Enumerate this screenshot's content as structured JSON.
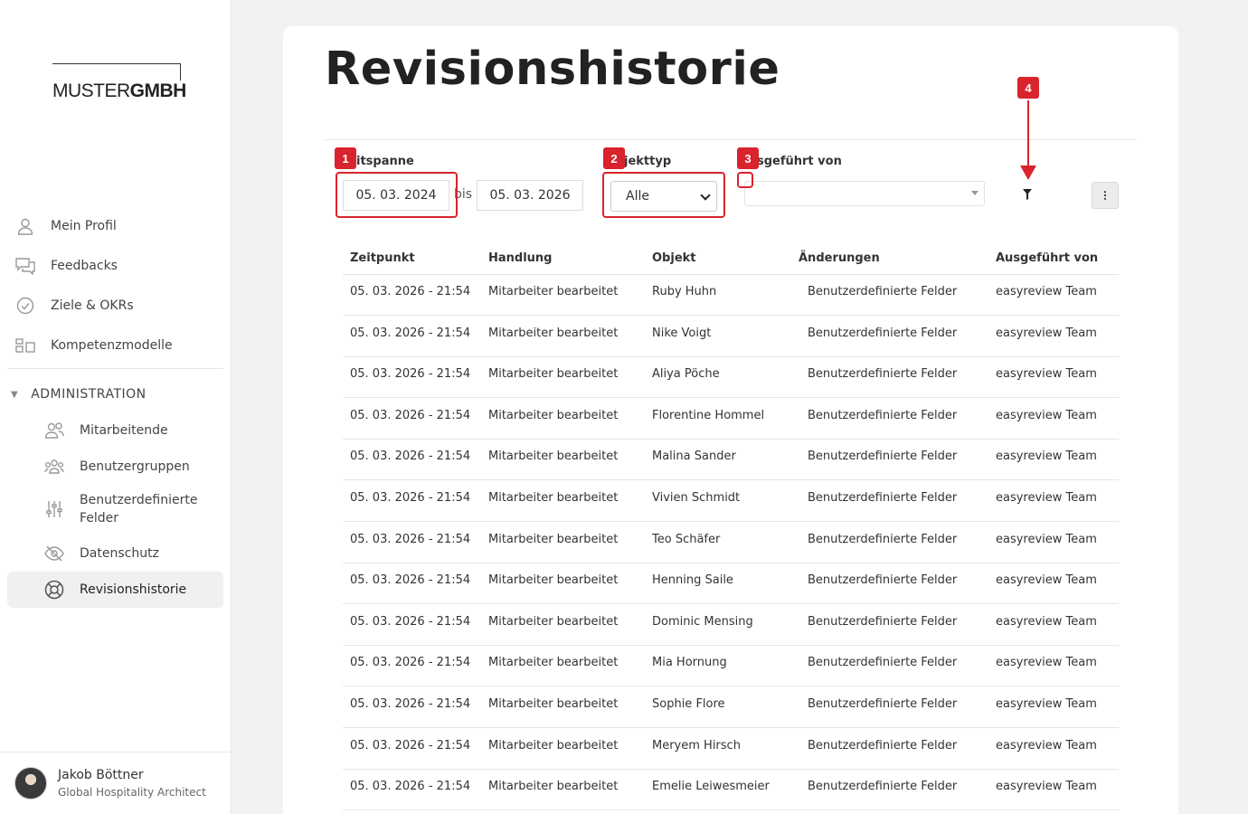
{
  "brand": {
    "logo_thin": "MUSTER",
    "logo_bold": "GMBH"
  },
  "sidebar": {
    "items": [
      {
        "label": "Mein Profil",
        "icon": "person-icon"
      },
      {
        "label": "Feedbacks",
        "icon": "chat-icon"
      },
      {
        "label": "Ziele & OKRs",
        "icon": "check-circle-icon"
      },
      {
        "label": "Kompetenzmodelle",
        "icon": "grid-icon"
      }
    ],
    "admin_heading": "ADMINISTRATION",
    "admin_items": [
      {
        "label": "Mitarbeitende",
        "icon": "people-icon"
      },
      {
        "label": "Benutzergruppen",
        "icon": "group-icon"
      },
      {
        "label": "Benutzerdefinierte Felder",
        "icon": "sliders-icon"
      },
      {
        "label": "Datenschutz",
        "icon": "eye-off-icon"
      },
      {
        "label": "Revisionshistorie",
        "icon": "lifebuoy-icon",
        "active": true
      }
    ]
  },
  "user": {
    "name": "Jakob Böttner",
    "role": "Global Hospitality Architect"
  },
  "page": {
    "title": "Revisionshistorie"
  },
  "filters": {
    "zeitspanne_label": "itspanne",
    "date_from": "05. 03. 2024",
    "bis": "bis",
    "date_to": "05. 03. 2026",
    "objekttyp_label": "jekttyp",
    "objekttyp_value": "Alle",
    "ausgefuehrt_label": "sgeführt von",
    "ausgefuehrt_value": ""
  },
  "annotations": [
    "1",
    "2",
    "3",
    "4"
  ],
  "table": {
    "headers": [
      "Zeitpunkt",
      "Handlung",
      "Objekt",
      "Änderungen",
      "Ausgeführt von"
    ],
    "rows": [
      [
        "05. 03. 2026 - 21:54",
        "Mitarbeiter bearbeitet",
        "Ruby Huhn",
        "Benutzerdefinierte Felder",
        "easyreview Team"
      ],
      [
        "05. 03. 2026 - 21:54",
        "Mitarbeiter bearbeitet",
        "Nike Voigt",
        "Benutzerdefinierte Felder",
        "easyreview Team"
      ],
      [
        "05. 03. 2026 - 21:54",
        "Mitarbeiter bearbeitet",
        "Aliya Pöche",
        "Benutzerdefinierte Felder",
        "easyreview Team"
      ],
      [
        "05. 03. 2026 - 21:54",
        "Mitarbeiter bearbeitet",
        "Florentine Hommel",
        "Benutzerdefinierte Felder",
        "easyreview Team"
      ],
      [
        "05. 03. 2026 - 21:54",
        "Mitarbeiter bearbeitet",
        "Malina Sander",
        "Benutzerdefinierte Felder",
        "easyreview Team"
      ],
      [
        "05. 03. 2026 - 21:54",
        "Mitarbeiter bearbeitet",
        "Vivien Schmidt",
        "Benutzerdefinierte Felder",
        "easyreview Team"
      ],
      [
        "05. 03. 2026 - 21:54",
        "Mitarbeiter bearbeitet",
        "Teo Schäfer",
        "Benutzerdefinierte Felder",
        "easyreview Team"
      ],
      [
        "05. 03. 2026 - 21:54",
        "Mitarbeiter bearbeitet",
        "Henning Saile",
        "Benutzerdefinierte Felder",
        "easyreview Team"
      ],
      [
        "05. 03. 2026 - 21:54",
        "Mitarbeiter bearbeitet",
        "Dominic Mensing",
        "Benutzerdefinierte Felder",
        "easyreview Team"
      ],
      [
        "05. 03. 2026 - 21:54",
        "Mitarbeiter bearbeitet",
        "Mia Hornung",
        "Benutzerdefinierte Felder",
        "easyreview Team"
      ],
      [
        "05. 03. 2026 - 21:54",
        "Mitarbeiter bearbeitet",
        "Sophie Flore",
        "Benutzerdefinierte Felder",
        "easyreview Team"
      ],
      [
        "05. 03. 2026 - 21:54",
        "Mitarbeiter bearbeitet",
        "Meryem Hirsch",
        "Benutzerdefinierte Felder",
        "easyreview Team"
      ],
      [
        "05. 03. 2026 - 21:54",
        "Mitarbeiter bearbeitet",
        "Emelie Leiwesmeier",
        "Benutzerdefinierte Felder",
        "easyreview Team"
      ]
    ]
  }
}
